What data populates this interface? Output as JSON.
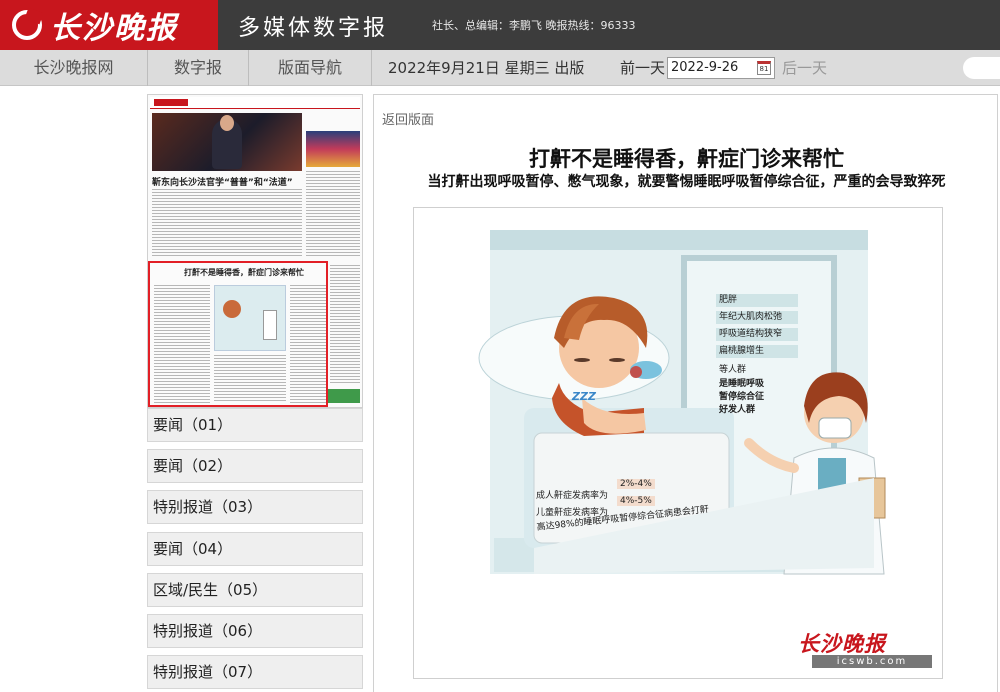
{
  "header": {
    "logo_text": "长沙晚报",
    "site_title": "多媒体数字报",
    "editor_line": "社长、总编辑：李鹏飞 晚报热线：96333"
  },
  "nav": {
    "items": [
      "长沙晚报网",
      "数字报",
      "版面导航"
    ],
    "date_text": "2022年9月21日 星期三 出版",
    "prev_label": "前一天",
    "date_value": "2022-9-26",
    "calendar_icon_text": "81",
    "next_label": "后一天"
  },
  "thumbnail": {
    "headline": "靳东向长沙法官学“普普”和“法道”",
    "selected_title": "打鼾不是睡得香，鼾症门诊来帮忙"
  },
  "sections": [
    "要闻（01）",
    "要闻（02）",
    "特别报道（03）",
    "要闻（04）",
    "区域/民生（05）",
    "特别报道（06）",
    "特别报道（07）"
  ],
  "article": {
    "back_label": "返回版面",
    "title": "打鼾不是睡得香，鼾症门诊来帮忙",
    "subtitle": "当打鼾出现呼吸暂停、憋气现象，就要警惕睡眠呼吸暂停综合征，严重的会导致猝死"
  },
  "figure": {
    "risk_list": [
      "肥胖",
      "年纪大肌肉松弛",
      "呼吸道结构狭窄",
      "扁桃腺增生"
    ],
    "etc_label": "等人群",
    "risk_conclusion": [
      "是睡眠呼吸",
      "暂停综合征",
      "好发人群"
    ],
    "zzz": "ZZZ",
    "stats": [
      {
        "label": "成人鼾症发病率为",
        "value": "2%-4%"
      },
      {
        "label": "儿童鼾症发病率为",
        "value": "4%-5%"
      }
    ],
    "stat_note": "高达98%的睡眠呼吸暂停综合征病患会打鼾",
    "logo_name": "长沙晚报",
    "logo_url": "icswb.com"
  }
}
